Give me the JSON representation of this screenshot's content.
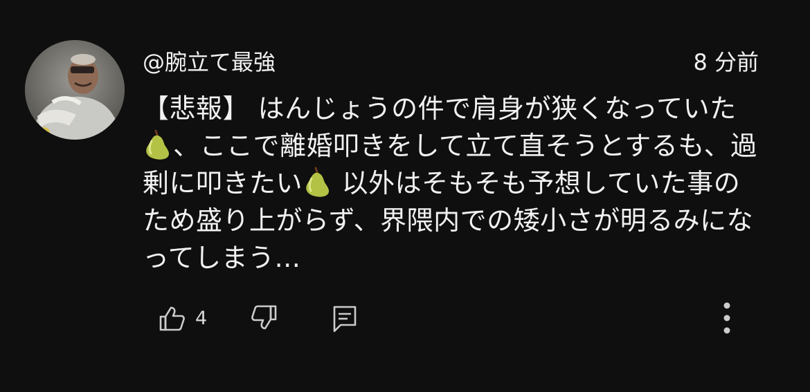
{
  "comment": {
    "author": "@腕立て最強",
    "timestamp": "8 分前",
    "body_segments": [
      "【悲報】 はんじょうの件で肩身が狭くなっていた",
      "、ここで離婚叩きをして立て直そうとするも、過剰に叩きたい",
      " 以外はそもそも予想していた事のため盛り上がらず、界隈内での矮小さが明るみになってしまう..."
    ],
    "emoji": {
      "inline_1": "pear-emoji",
      "inline_2": "pear-emoji"
    }
  },
  "actions": {
    "like_count": "4",
    "like_icon": "thumbs-up-icon",
    "dislike_icon": "thumbs-down-icon",
    "reply_icon": "reply-comment-icon",
    "more_icon": "more-vertical-icon"
  },
  "colors": {
    "background": "#0f0f0f",
    "text": "#f1f1f1",
    "icon": "#cccccc",
    "pear": "#b3c245"
  }
}
